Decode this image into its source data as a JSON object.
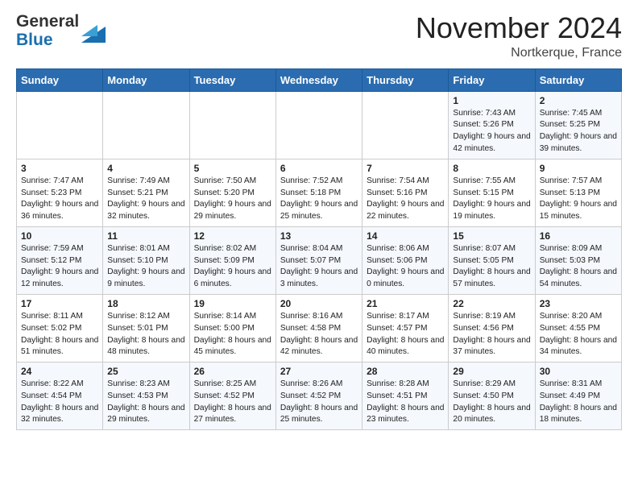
{
  "logo": {
    "general": "General",
    "blue": "Blue"
  },
  "header": {
    "month": "November 2024",
    "location": "Nortkerque, France"
  },
  "days_of_week": [
    "Sunday",
    "Monday",
    "Tuesday",
    "Wednesday",
    "Thursday",
    "Friday",
    "Saturday"
  ],
  "weeks": [
    [
      {
        "day": "",
        "info": ""
      },
      {
        "day": "",
        "info": ""
      },
      {
        "day": "",
        "info": ""
      },
      {
        "day": "",
        "info": ""
      },
      {
        "day": "",
        "info": ""
      },
      {
        "day": "1",
        "info": "Sunrise: 7:43 AM\nSunset: 5:26 PM\nDaylight: 9 hours and 42 minutes."
      },
      {
        "day": "2",
        "info": "Sunrise: 7:45 AM\nSunset: 5:25 PM\nDaylight: 9 hours and 39 minutes."
      }
    ],
    [
      {
        "day": "3",
        "info": "Sunrise: 7:47 AM\nSunset: 5:23 PM\nDaylight: 9 hours and 36 minutes."
      },
      {
        "day": "4",
        "info": "Sunrise: 7:49 AM\nSunset: 5:21 PM\nDaylight: 9 hours and 32 minutes."
      },
      {
        "day": "5",
        "info": "Sunrise: 7:50 AM\nSunset: 5:20 PM\nDaylight: 9 hours and 29 minutes."
      },
      {
        "day": "6",
        "info": "Sunrise: 7:52 AM\nSunset: 5:18 PM\nDaylight: 9 hours and 25 minutes."
      },
      {
        "day": "7",
        "info": "Sunrise: 7:54 AM\nSunset: 5:16 PM\nDaylight: 9 hours and 22 minutes."
      },
      {
        "day": "8",
        "info": "Sunrise: 7:55 AM\nSunset: 5:15 PM\nDaylight: 9 hours and 19 minutes."
      },
      {
        "day": "9",
        "info": "Sunrise: 7:57 AM\nSunset: 5:13 PM\nDaylight: 9 hours and 15 minutes."
      }
    ],
    [
      {
        "day": "10",
        "info": "Sunrise: 7:59 AM\nSunset: 5:12 PM\nDaylight: 9 hours and 12 minutes."
      },
      {
        "day": "11",
        "info": "Sunrise: 8:01 AM\nSunset: 5:10 PM\nDaylight: 9 hours and 9 minutes."
      },
      {
        "day": "12",
        "info": "Sunrise: 8:02 AM\nSunset: 5:09 PM\nDaylight: 9 hours and 6 minutes."
      },
      {
        "day": "13",
        "info": "Sunrise: 8:04 AM\nSunset: 5:07 PM\nDaylight: 9 hours and 3 minutes."
      },
      {
        "day": "14",
        "info": "Sunrise: 8:06 AM\nSunset: 5:06 PM\nDaylight: 9 hours and 0 minutes."
      },
      {
        "day": "15",
        "info": "Sunrise: 8:07 AM\nSunset: 5:05 PM\nDaylight: 8 hours and 57 minutes."
      },
      {
        "day": "16",
        "info": "Sunrise: 8:09 AM\nSunset: 5:03 PM\nDaylight: 8 hours and 54 minutes."
      }
    ],
    [
      {
        "day": "17",
        "info": "Sunrise: 8:11 AM\nSunset: 5:02 PM\nDaylight: 8 hours and 51 minutes."
      },
      {
        "day": "18",
        "info": "Sunrise: 8:12 AM\nSunset: 5:01 PM\nDaylight: 8 hours and 48 minutes."
      },
      {
        "day": "19",
        "info": "Sunrise: 8:14 AM\nSunset: 5:00 PM\nDaylight: 8 hours and 45 minutes."
      },
      {
        "day": "20",
        "info": "Sunrise: 8:16 AM\nSunset: 4:58 PM\nDaylight: 8 hours and 42 minutes."
      },
      {
        "day": "21",
        "info": "Sunrise: 8:17 AM\nSunset: 4:57 PM\nDaylight: 8 hours and 40 minutes."
      },
      {
        "day": "22",
        "info": "Sunrise: 8:19 AM\nSunset: 4:56 PM\nDaylight: 8 hours and 37 minutes."
      },
      {
        "day": "23",
        "info": "Sunrise: 8:20 AM\nSunset: 4:55 PM\nDaylight: 8 hours and 34 minutes."
      }
    ],
    [
      {
        "day": "24",
        "info": "Sunrise: 8:22 AM\nSunset: 4:54 PM\nDaylight: 8 hours and 32 minutes."
      },
      {
        "day": "25",
        "info": "Sunrise: 8:23 AM\nSunset: 4:53 PM\nDaylight: 8 hours and 29 minutes."
      },
      {
        "day": "26",
        "info": "Sunrise: 8:25 AM\nSunset: 4:52 PM\nDaylight: 8 hours and 27 minutes."
      },
      {
        "day": "27",
        "info": "Sunrise: 8:26 AM\nSunset: 4:52 PM\nDaylight: 8 hours and 25 minutes."
      },
      {
        "day": "28",
        "info": "Sunrise: 8:28 AM\nSunset: 4:51 PM\nDaylight: 8 hours and 23 minutes."
      },
      {
        "day": "29",
        "info": "Sunrise: 8:29 AM\nSunset: 4:50 PM\nDaylight: 8 hours and 20 minutes."
      },
      {
        "day": "30",
        "info": "Sunrise: 8:31 AM\nSunset: 4:49 PM\nDaylight: 8 hours and 18 minutes."
      }
    ]
  ]
}
